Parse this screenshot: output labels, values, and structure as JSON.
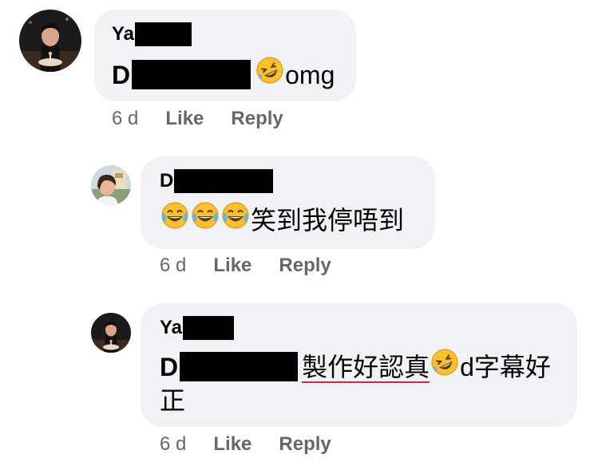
{
  "comments": [
    {
      "name_visible": "Ya",
      "text_prefix": "D",
      "text": "omg",
      "time": "6 d",
      "like": "Like",
      "reply": "Reply",
      "emoji": [
        "rolling-on-floor-laughing-icon"
      ]
    },
    {
      "name_visible": "D",
      "text": "笑到我停唔到",
      "time": "6 d",
      "like": "Like",
      "reply": "Reply",
      "emoji": [
        "face-with-tears-of-joy-icon",
        "face-with-tears-of-joy-icon",
        "face-with-tears-of-joy-icon"
      ]
    },
    {
      "name_visible": "Ya",
      "text_prefix": "D",
      "text_underlined": "製作好認真",
      "text_after": "d字幕好",
      "text_line2": "正",
      "time": "6 d",
      "like": "Like",
      "reply": "Reply",
      "emoji": [
        "rolling-on-floor-laughing-icon"
      ]
    }
  ],
  "colors": {
    "bubble": "#f0f2f5",
    "meta": "#65676b",
    "spellcheck_underline": "#e41e3f"
  }
}
